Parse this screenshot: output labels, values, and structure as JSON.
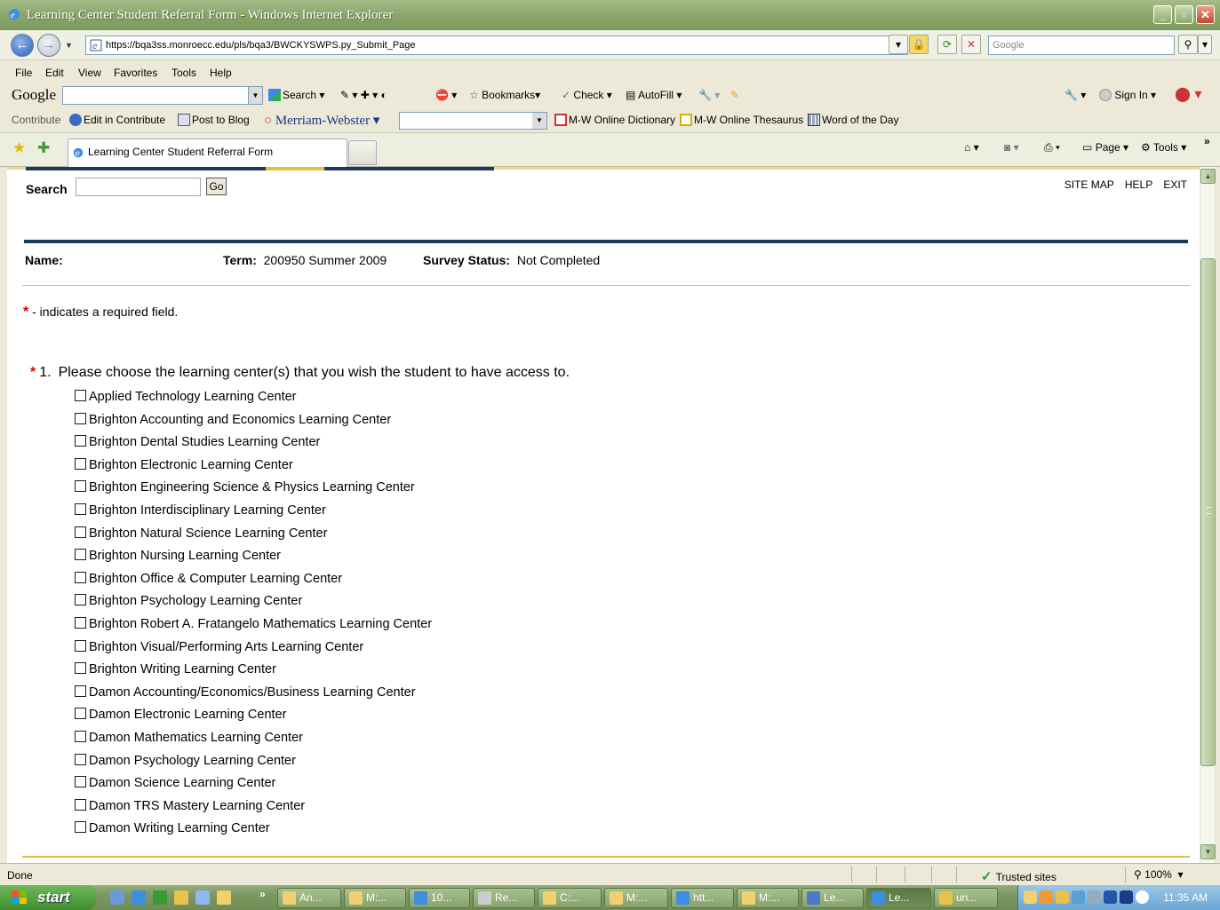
{
  "window": {
    "title": "Learning Center Student Referral Form - Windows Internet Explorer"
  },
  "address_bar": {
    "url": "https://bqa3ss.monroecc.edu/pls/bqa3/BWCKYSWPS.py_Submit_Page",
    "search_placeholder": "Google"
  },
  "menu": [
    "File",
    "Edit",
    "View",
    "Favorites",
    "Tools",
    "Help"
  ],
  "google_toolbar": {
    "logo": "Google",
    "search_label": "Search",
    "bookmarks_label": "Bookmarks",
    "check_label": "Check",
    "autofill_label": "AutoFill",
    "sign_in_label": "Sign In"
  },
  "contribute_toolbar": {
    "contribute_label": "Contribute",
    "edit_in_contribute": "Edit in Contribute",
    "post_to_blog": "Post to Blog",
    "merriam_webster": "Merriam-Webster",
    "mw_dictionary": "M-W Online Dictionary",
    "mw_thesaurus": "M-W Online Thesaurus",
    "word_of_day": "Word of the Day"
  },
  "tab_bar": {
    "active_tab": "Learning Center Student Referral Form",
    "page_label": "Page",
    "tools_label": "Tools"
  },
  "page": {
    "search_label": "Search",
    "go_label": "Go",
    "top_links": [
      "SITE MAP",
      "HELP",
      "EXIT"
    ],
    "name_label": "Name:",
    "term_label": "Term:",
    "term_value": "200950 Summer 2009",
    "survey_status_label": "Survey Status:",
    "survey_status_value": "Not Completed",
    "required_star": "*",
    "required_note": " - indicates a required field.",
    "question_number": "1.",
    "question_text": "Please choose the learning center(s) that you wish the student to have access to.",
    "options": [
      "Applied Technology Learning Center",
      "Brighton Accounting and Economics Learning Center",
      "Brighton Dental Studies Learning Center",
      "Brighton Electronic Learning Center",
      "Brighton Engineering Science & Physics Learning Center",
      "Brighton Interdisciplinary Learning Center",
      "Brighton Natural Science Learning Center",
      "Brighton Nursing Learning Center",
      "Brighton Office & Computer Learning Center",
      "Brighton Psychology Learning Center",
      "Brighton Robert A. Fratangelo Mathematics Learning Center",
      "Brighton Visual/Performing Arts Learning Center",
      "Brighton Writing Learning Center",
      "Damon Accounting/Economics/Business Learning Center",
      "Damon Electronic Learning Center",
      "Damon Mathematics Learning Center",
      "Damon Psychology Learning Center",
      "Damon Science Learning Center",
      "Damon TRS Mastery Learning Center",
      "Damon Writing Learning Center"
    ]
  },
  "status_bar": {
    "status": "Done",
    "zone": "Trusted sites",
    "zoom": "100%"
  },
  "taskbar": {
    "start_label": "start",
    "tasks": [
      "An...",
      "M:...",
      "10...",
      "Re...",
      "C:...",
      "M:...",
      "htt...",
      "M:...",
      "Le...",
      "Le...",
      "un..."
    ],
    "clock": "11:35 AM"
  },
  "colors": {
    "titlebar": "#8aa56a",
    "navy_rule": "#1a3a5e",
    "gold_rule": "#d4c24a",
    "required": "#dd0000"
  }
}
